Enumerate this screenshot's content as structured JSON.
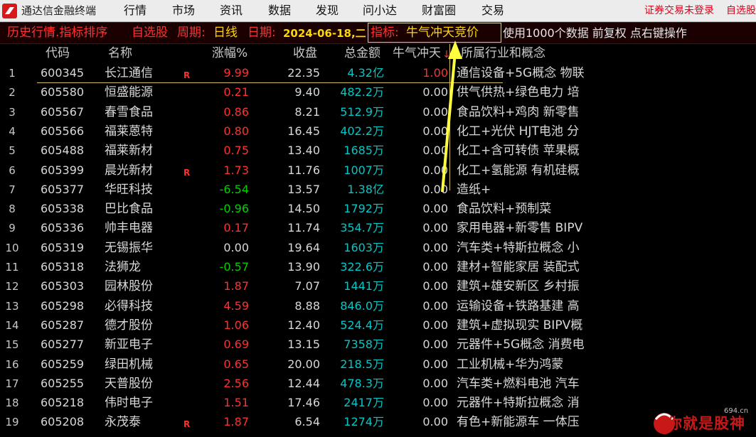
{
  "app": {
    "title": "通达信金融终端"
  },
  "menu": [
    "行情",
    "市场",
    "资讯",
    "数据",
    "发现",
    "问小达",
    "财富圈",
    "交易"
  ],
  "menu_right": {
    "login": "证券交易未登录",
    "zixuan": "自选股"
  },
  "infobar": {
    "prefix": "历史行情.指标排序",
    "zixuan": "自选股",
    "period_label": "周期:",
    "period_value": "日线",
    "date_label": "日期:",
    "date_value": "2024-06-18,二",
    "indicator_label": "指标:",
    "indicator_value": "牛气冲天竞价",
    "suffix": "使用1000个数据 前复权 点右键操作"
  },
  "headers": {
    "code": "代码",
    "name": "名称",
    "change": "涨幅%",
    "close": "收盘",
    "amount": "总金额",
    "indicator": "牛气冲天",
    "sort_mark": "↓",
    "concept": "所属行业和概念"
  },
  "rows": [
    {
      "idx": "1",
      "code": "600345",
      "name": "长江通信",
      "flag": "R",
      "chg": "9.99",
      "dir": "up",
      "close": "22.35",
      "amt": "4.32亿",
      "ind": "1.00",
      "concept": "通信设备+5G概念 物联"
    },
    {
      "idx": "2",
      "code": "605580",
      "name": "恒盛能源",
      "flag": "",
      "chg": "0.21",
      "dir": "up",
      "close": "9.40",
      "amt": "482.2万",
      "ind": "0.00",
      "concept": "供气供热+绿色电力 培"
    },
    {
      "idx": "3",
      "code": "605567",
      "name": "春雪食品",
      "flag": "",
      "chg": "0.86",
      "dir": "up",
      "close": "8.21",
      "amt": "512.9万",
      "ind": "0.00",
      "concept": "食品饮料+鸡肉 新零售"
    },
    {
      "idx": "4",
      "code": "605566",
      "name": "福莱蒽特",
      "flag": "",
      "chg": "0.80",
      "dir": "up",
      "close": "16.45",
      "amt": "402.2万",
      "ind": "0.00",
      "concept": "化工+光伏 HJT电池 分"
    },
    {
      "idx": "5",
      "code": "605488",
      "name": "福莱新材",
      "flag": "",
      "chg": "0.75",
      "dir": "up",
      "close": "13.40",
      "amt": "1685万",
      "ind": "0.00",
      "concept": "化工+含可转债 苹果概"
    },
    {
      "idx": "6",
      "code": "605399",
      "name": "晨光新材",
      "flag": "R",
      "chg": "1.73",
      "dir": "up",
      "close": "11.76",
      "amt": "1007万",
      "ind": "0.00",
      "concept": "化工+氢能源 有机硅概"
    },
    {
      "idx": "7",
      "code": "605377",
      "name": "华旺科技",
      "flag": "",
      "chg": "-6.54",
      "dir": "dn",
      "close": "13.57",
      "amt": "1.38亿",
      "ind": "0.00",
      "concept": "造纸+"
    },
    {
      "idx": "8",
      "code": "605338",
      "name": "巴比食品",
      "flag": "",
      "chg": "-0.96",
      "dir": "dn",
      "close": "14.50",
      "amt": "1792万",
      "ind": "0.00",
      "concept": "食品饮料+预制菜"
    },
    {
      "idx": "9",
      "code": "605336",
      "name": "帅丰电器",
      "flag": "",
      "chg": "0.17",
      "dir": "up",
      "close": "11.74",
      "amt": "354.7万",
      "ind": "0.00",
      "concept": "家用电器+新零售 BIPV"
    },
    {
      "idx": "10",
      "code": "605319",
      "name": "无锡振华",
      "flag": "",
      "chg": "0.00",
      "dir": "flat",
      "close": "19.64",
      "amt": "1603万",
      "ind": "0.00",
      "concept": "汽车类+特斯拉概念 小"
    },
    {
      "idx": "11",
      "code": "605318",
      "name": "法狮龙",
      "flag": "",
      "chg": "-0.57",
      "dir": "dn",
      "close": "13.90",
      "amt": "322.6万",
      "ind": "0.00",
      "concept": "建材+智能家居 装配式"
    },
    {
      "idx": "12",
      "code": "605303",
      "name": "园林股份",
      "flag": "",
      "chg": "1.87",
      "dir": "up",
      "close": "7.07",
      "amt": "1441万",
      "ind": "0.00",
      "concept": "建筑+雄安新区 乡村振"
    },
    {
      "idx": "13",
      "code": "605298",
      "name": "必得科技",
      "flag": "",
      "chg": "4.59",
      "dir": "up",
      "close": "8.88",
      "amt": "846.0万",
      "ind": "0.00",
      "concept": "运输设备+铁路基建 高"
    },
    {
      "idx": "14",
      "code": "605287",
      "name": "德才股份",
      "flag": "",
      "chg": "1.06",
      "dir": "up",
      "close": "12.40",
      "amt": "524.4万",
      "ind": "0.00",
      "concept": "建筑+虚拟现实 BIPV概"
    },
    {
      "idx": "15",
      "code": "605277",
      "name": "新亚电子",
      "flag": "",
      "chg": "0.69",
      "dir": "up",
      "close": "13.15",
      "amt": "7358万",
      "ind": "0.00",
      "concept": "元器件+5G概念 消费电"
    },
    {
      "idx": "16",
      "code": "605259",
      "name": "绿田机械",
      "flag": "",
      "chg": "0.65",
      "dir": "up",
      "close": "20.00",
      "amt": "218.5万",
      "ind": "0.00",
      "concept": "工业机械+华为鸿蒙"
    },
    {
      "idx": "17",
      "code": "605255",
      "name": "天普股份",
      "flag": "",
      "chg": "2.56",
      "dir": "up",
      "close": "12.44",
      "amt": "478.3万",
      "ind": "0.00",
      "concept": "汽车类+燃料电池 汽车"
    },
    {
      "idx": "18",
      "code": "605218",
      "name": "伟时电子",
      "flag": "",
      "chg": "1.51",
      "dir": "up",
      "close": "17.46",
      "amt": "2417万",
      "ind": "0.00",
      "concept": "元器件+特斯拉概念 消"
    },
    {
      "idx": "19",
      "code": "605208",
      "name": "永茂泰",
      "flag": "R",
      "chg": "1.87",
      "dir": "up",
      "close": "6.54",
      "amt": "1274万",
      "ind": "0.00",
      "concept": "有色+新能源车 一体压"
    }
  ],
  "watermark": {
    "text": "你就是股神",
    "site": "694.cn"
  },
  "colors": {
    "up": "#ff3030",
    "down": "#00d000",
    "amount": "#00c8c8",
    "info_red": "#ff3030",
    "info_yellow": "#ffd700",
    "annotation": "#ffff40"
  }
}
